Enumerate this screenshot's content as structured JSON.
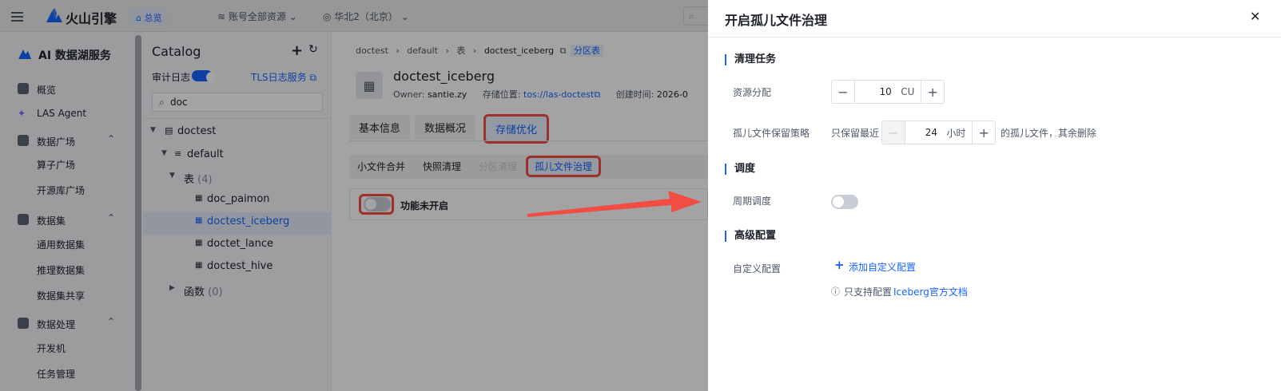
{
  "header": {
    "brand": "火山引擎",
    "home_badge": "总览",
    "account_scope": "账号全部资源",
    "region": "华北2（北京）"
  },
  "sidebar": {
    "title": "AI 数据湖服务",
    "items": [
      {
        "label": "概览"
      },
      {
        "label": "LAS Agent"
      },
      {
        "label": "数据广场"
      },
      {
        "label": "算子广场"
      },
      {
        "label": "开源库广场"
      },
      {
        "label": "数据集"
      },
      {
        "label": "通用数据集"
      },
      {
        "label": "推理数据集"
      },
      {
        "label": "数据集共享"
      },
      {
        "label": "数据处理"
      },
      {
        "label": "开发机"
      },
      {
        "label": "任务管理"
      }
    ]
  },
  "catalog": {
    "title": "Catalog",
    "audit_log_label": "审计日志",
    "tls_link": "TLS日志服务",
    "search_value": "doc",
    "tree": {
      "db_root": "doctest",
      "schema": "default",
      "tables_label": "表",
      "tables_count": "(4)",
      "tables": [
        "doc_paimon",
        "doctest_iceberg",
        "doctet_lance",
        "doctest_hive"
      ],
      "functions_label": "函数",
      "functions_count": "(0)"
    }
  },
  "main": {
    "breadcrumb": [
      "doctest",
      "default",
      "表",
      "doctest_iceberg"
    ],
    "partition_badge": "分区表",
    "table_name": "doctest_iceberg",
    "owner_label": "Owner:",
    "owner_value": "santie.zy",
    "storage_label": "存储位置:",
    "storage_value": "tos://las-doctest",
    "created_label": "创建时间:",
    "created_value": "2026-0",
    "tabs": [
      "基本信息",
      "数据概况",
      "存储优化"
    ],
    "subtabs": [
      "小文件合并",
      "快照清理",
      "分区清理",
      "孤儿文件治理"
    ],
    "feature_status": "功能未开启"
  },
  "drawer": {
    "title": "开启孤儿文件治理",
    "section_cleanup": "清理任务",
    "resource_label": "资源分配",
    "resource_value": "10",
    "resource_unit": "CU",
    "retention_label": "孤儿文件保留策略",
    "retention_prefix": "只保留最近",
    "retention_value": "24",
    "retention_unit": "小时",
    "retention_suffix": "的孤儿文件，其余删除",
    "section_schedule": "调度",
    "periodic_label": "周期调度",
    "periodic_enabled": false,
    "section_advanced": "高级配置",
    "custom_label": "自定义配置",
    "add_custom": "添加自定义配置",
    "hint_prefix": "只支持配置",
    "hint_link": "Iceberg官方文档"
  },
  "colors": {
    "accent": "#1664ff",
    "highlight": "#f24d43"
  }
}
